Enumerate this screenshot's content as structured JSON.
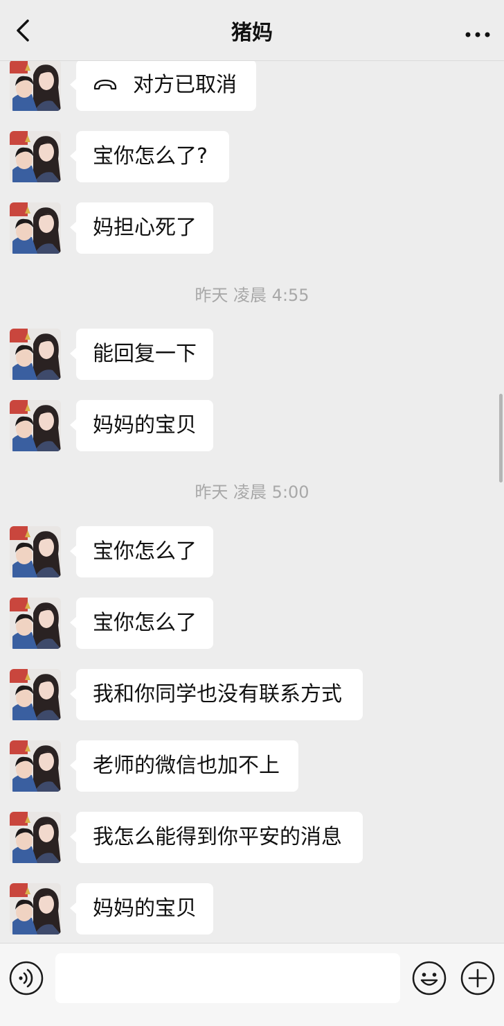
{
  "header": {
    "title": "猪妈"
  },
  "messages": [
    {
      "type": "call",
      "text": "对方已取消"
    },
    {
      "type": "text",
      "text": "宝你怎么了?"
    },
    {
      "type": "text",
      "text": "妈担心死了"
    },
    {
      "type": "time",
      "text": "昨天 凌晨 4:55"
    },
    {
      "type": "text",
      "text": "能回复一下"
    },
    {
      "type": "text",
      "text": "妈妈的宝贝"
    },
    {
      "type": "time",
      "text": "昨天 凌晨 5:00"
    },
    {
      "type": "text",
      "text": "宝你怎么了"
    },
    {
      "type": "text",
      "text": "宝你怎么了"
    },
    {
      "type": "text",
      "text": "我和你同学也没有联系方式"
    },
    {
      "type": "text",
      "text": "老师的微信也加不上"
    },
    {
      "type": "text",
      "text": "我怎么能得到你平安的消息"
    },
    {
      "type": "text",
      "text": "妈妈的宝贝"
    }
  ],
  "input": {
    "value": "",
    "placeholder": ""
  },
  "icons": {
    "back": "back-arrow-icon",
    "more": "more-dots-icon",
    "voice": "voice-icon",
    "emoji": "emoji-icon",
    "plus": "plus-icon",
    "call": "hangup-icon"
  },
  "colors": {
    "background": "#EDEDED",
    "bubble": "#FFFFFF",
    "timestamp": "#A8A8A8"
  }
}
